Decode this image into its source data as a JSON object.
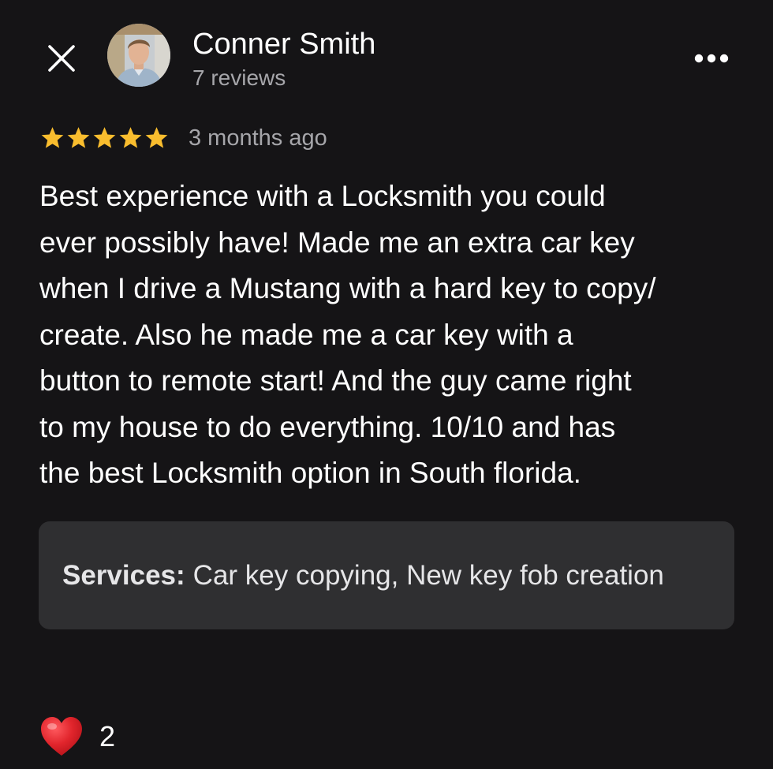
{
  "header": {
    "close_icon": "close-icon",
    "more_icon": "more-horizontal-icon",
    "reviewer_name": "Conner Smith",
    "review_count": "7 reviews"
  },
  "review": {
    "rating": 5,
    "rating_max": 5,
    "star_color": "#f9bd2e",
    "date": "3 months ago",
    "text": "Best experience with a Locksmith you could\never possibly have! Made me an extra car key\nwhen I drive a Mustang with a hard key to copy/\ncreate. Also he made me a car key with a\nbutton to remote start! And the guy came right\nto my house to do everything. 10/10 and has\nthe best Locksmith option in South florida."
  },
  "services": {
    "label": "Services:",
    "value": "Car key copying, New key fob creation"
  },
  "reactions": {
    "icon": "heart-icon",
    "heart_color": "#e1252c",
    "count": "2"
  },
  "colors": {
    "background": "#151416",
    "secondary_text": "#a6a6aa",
    "services_background": "#2f2f31"
  }
}
